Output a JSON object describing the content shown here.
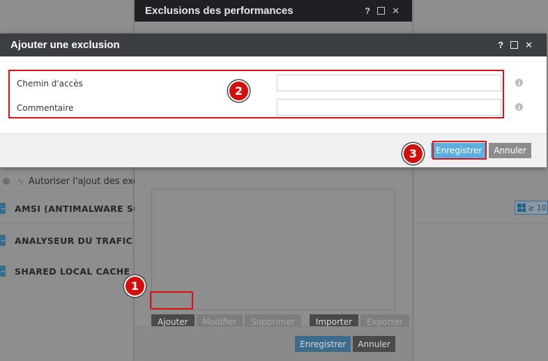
{
  "background": {
    "toggle_text": "Autoriser l'ajout des exclus",
    "sections": [
      {
        "title": "AMSI (ANTIMALWARE SCAN"
      },
      {
        "title": "ANALYSEUR DU TRAFIC RÉS"
      },
      {
        "title": "SHARED LOCAL CACHE"
      }
    ],
    "os_badge": "≥ 10"
  },
  "perf_dialog": {
    "title": "Exclusions des performances",
    "help": "?",
    "close": "✕",
    "buttons": {
      "add": "Ajouter",
      "modify": "Modifier",
      "delete": "Supprimer",
      "import": "Importer",
      "export": "Exporter"
    },
    "footer": {
      "save": "Enregistrer",
      "cancel": "Annuler"
    }
  },
  "add_dialog": {
    "title": "Ajouter une exclusion",
    "help": "?",
    "close": "✕",
    "fields": {
      "path_label": "Chemin d'accès",
      "path_value": "",
      "comment_label": "Commentaire",
      "comment_value": ""
    },
    "info": "i",
    "footer": {
      "save": "Enregistrer",
      "cancel": "Annuler"
    }
  },
  "annotations": {
    "step1": "1",
    "step2": "2",
    "step3": "3"
  },
  "colors": {
    "highlight": "#e01010",
    "save_blue": "#5aaee0",
    "header_dark": "#3a3d41"
  }
}
